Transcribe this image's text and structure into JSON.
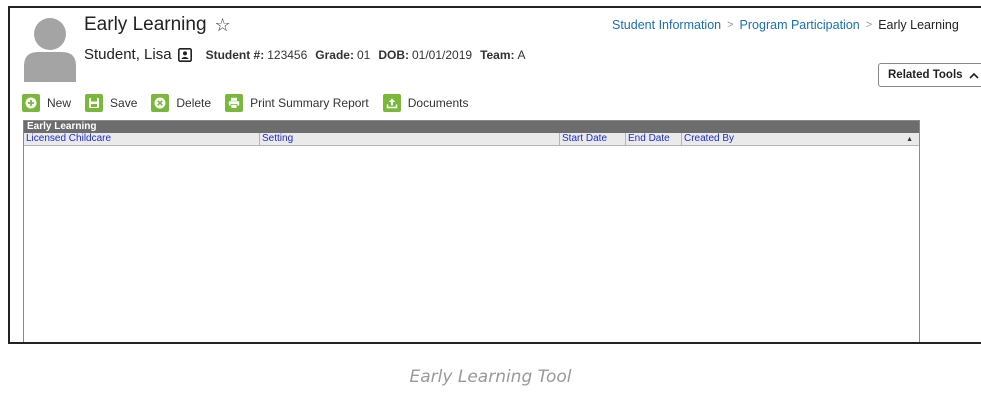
{
  "header": {
    "title": "Early Learning",
    "student_name": "Student, Lisa",
    "student_number_label": "Student #:",
    "student_number": "123456",
    "grade_label": "Grade:",
    "grade": "01",
    "dob_label": "DOB:",
    "dob": "01/01/2019",
    "team_label": "Team:",
    "team": "A"
  },
  "breadcrumb": {
    "items": [
      "Student Information",
      "Program Participation"
    ],
    "current": "Early Learning"
  },
  "related_tools": {
    "label": "Related Tools"
  },
  "toolbar": {
    "new_label": "New",
    "save_label": "Save",
    "delete_label": "Delete",
    "print_label": "Print Summary Report",
    "documents_label": "Documents"
  },
  "grid": {
    "title": "Early Learning",
    "columns": [
      "Licensed Childcare",
      "Setting",
      "Start Date",
      "End Date",
      "Created By"
    ],
    "rows": []
  },
  "caption": "Early Learning Tool",
  "colors": {
    "accent_green": "#7ab83c",
    "link_blue": "#1a6fb5",
    "column_blue": "#1c2cd6",
    "grid_title_gray": "#6d6d6d"
  },
  "icons": {
    "star": "star-outline-icon",
    "id_card": "id-card-icon",
    "new": "plus-circle-icon",
    "save": "floppy-disk-icon",
    "delete": "x-circle-icon",
    "print": "printer-icon",
    "documents": "upload-icon"
  }
}
